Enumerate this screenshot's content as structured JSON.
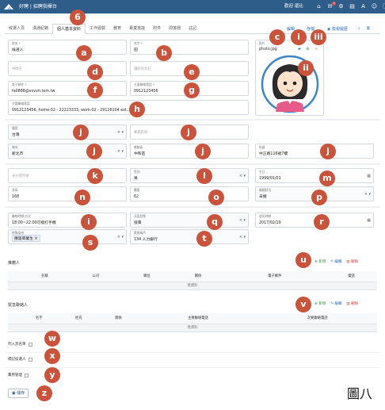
{
  "app": {
    "title": "好聘 | 招聘指揮台",
    "welcome": "歡迎 還比"
  },
  "topbar_icons": [
    {
      "icon": "home-icon",
      "count": ""
    },
    {
      "icon": "mail-icon",
      "count": "3"
    },
    {
      "icon": "gear-icon",
      "count": ""
    },
    {
      "icon": "document-icon",
      "count": ""
    },
    {
      "icon": "font-a-icon",
      "count": ""
    },
    {
      "icon": "user-icon",
      "count": ""
    },
    {
      "icon": "info-icon",
      "count": ""
    },
    {
      "icon": "expand-icon",
      "count": ""
    }
  ],
  "tabs": [
    "候選人頁",
    "溝通紀錄",
    "個人基本資料",
    "工作經驗",
    "教育",
    "專業技能",
    "附件",
    "問答題",
    "註記"
  ],
  "active_tab": 2,
  "tab_actions": {
    "edit": "編輯",
    "save": "存檔",
    "preview": "檢視履歷"
  },
  "fields": {
    "name": {
      "label": "姓名 *",
      "value": "候選人"
    },
    "given_name": {
      "label": "名字 *",
      "value": "田"
    },
    "middle_name": {
      "placeholder": "中間名"
    },
    "english_name": {
      "placeholder": "護照英文名"
    },
    "email": {
      "label": "電子郵件 *",
      "value": "fa0888@vvvvn.tom.tw"
    },
    "main_phone": {
      "label": "主要聯絡電話 *",
      "value": "0912123456"
    },
    "secondary_phone": {
      "label": "次要聯絡電話",
      "value": "0912123456, home:02 - 22223333, work:02 - 29126104 ext..."
    },
    "photo": {
      "label": "照片",
      "value": "photo.jpg"
    },
    "country": {
      "label": "國家",
      "value": "台灣"
    },
    "postal_code": {
      "placeholder": "郵遞區號"
    },
    "city": {
      "label": "城市",
      "value": "新北市"
    },
    "district": {
      "label": "鄉鎮區",
      "value": "中和區"
    },
    "street": {
      "label": "街道",
      "value": "中正路116號7樓"
    },
    "id_number": {
      "placeholder": "身分證字號"
    },
    "gender": {
      "label": "性別",
      "value": "男"
    },
    "birthday": {
      "label": "生日",
      "value": "1999/01/01"
    },
    "height": {
      "label": "身高",
      "value": "168"
    },
    "weight": {
      "label": "體重",
      "value": "62"
    },
    "marital": {
      "label": "婚姻狀況",
      "value": "未婚"
    },
    "contact_time": {
      "label": "聯絡時間/方式",
      "value": "18:00~22:00可撥打手機"
    },
    "military": {
      "label": "兵役狀態",
      "value": "役畢"
    },
    "graduation": {
      "label": "退伍時間",
      "value": "2017/02/19"
    },
    "special_status": {
      "label": "特殊身份",
      "value": "應屆畢業生"
    },
    "bank": {
      "label": "薪資帳戶",
      "value": "134 人力銀行"
    }
  },
  "badges": [
    "a",
    "b",
    "c",
    "d",
    "e",
    "f",
    "g",
    "h",
    "i",
    "ii",
    "iii",
    "j",
    "k",
    "l",
    "m",
    "n",
    "o",
    "p",
    "q",
    "r",
    "s",
    "t",
    "u",
    "v",
    "w",
    "x",
    "y",
    "z",
    "6"
  ],
  "referees": {
    "title": "推薦人",
    "columns": [
      "名稱",
      "公司",
      "職位",
      "關係",
      "電子郵件",
      "電話"
    ],
    "empty": "無資料"
  },
  "emergency": {
    "title": "緊急聯絡人",
    "columns": [
      "名字",
      "姓氏",
      "關係",
      "主要聯絡電話",
      "次要聯絡電話"
    ],
    "empty": "無資料"
  },
  "actions": {
    "add": "新增",
    "edit": "編輯",
    "delete": "刪除"
  },
  "checks": [
    "列入黑名單",
    "標記侯選人",
    "費用管理"
  ],
  "save_button": "儲存",
  "caption": "圖八"
}
